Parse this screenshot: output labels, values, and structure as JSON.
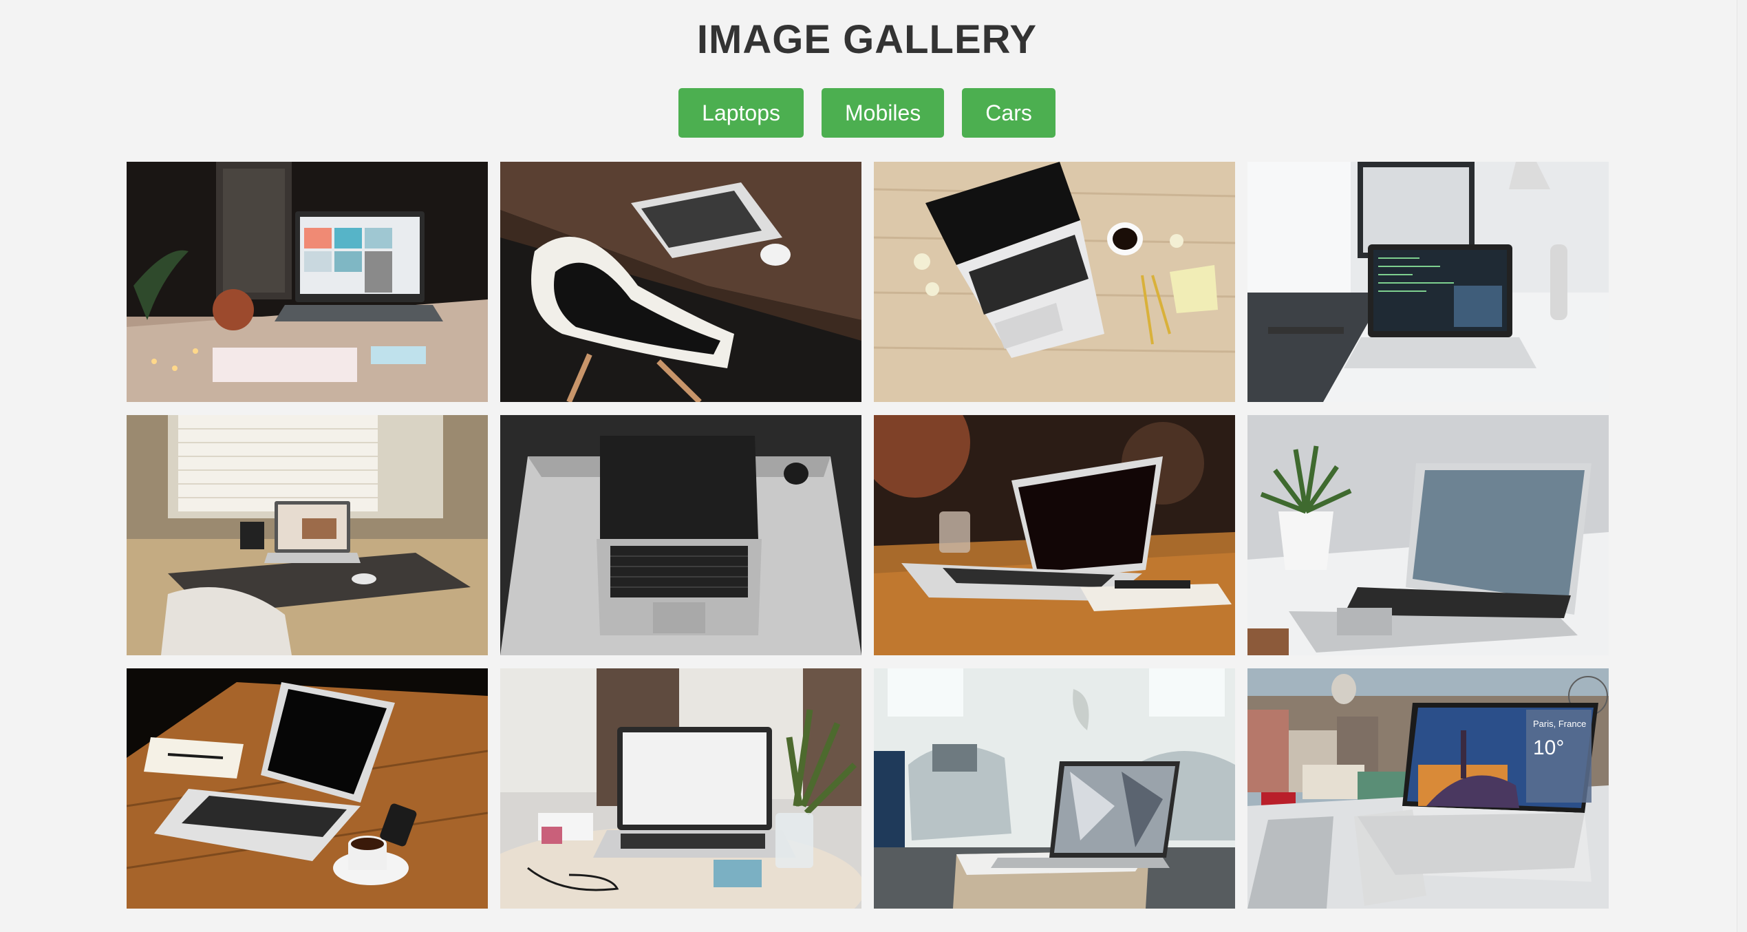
{
  "gallery": {
    "title": "IMAGE GALLERY",
    "filters": [
      {
        "label": "Laptops"
      },
      {
        "label": "Mobiles"
      },
      {
        "label": "Cars"
      }
    ],
    "accent_color": "#4caf50",
    "images": [
      {
        "subject": "laptop on wooden desk with fairy lights and copper mug"
      },
      {
        "subject": "laptop on dark wooden desk with white chair"
      },
      {
        "subject": "laptop top view on light wood with coffee cup"
      },
      {
        "subject": "laptop with code on white desk near window"
      },
      {
        "subject": "laptop on desk by window with blinds"
      },
      {
        "subject": "laptop on white table top view dark"
      },
      {
        "subject": "laptop on wooden table with glass, warm light"
      },
      {
        "subject": "laptop on white desk with potted plant"
      },
      {
        "subject": "laptop on wooden table with notebook and espresso"
      },
      {
        "subject": "laptop on round table with plant and glass"
      },
      {
        "subject": "laptop on marble stand in living room"
      },
      {
        "subject": "laptop with Paris weather screen, city background",
        "screen_text": "Paris, France",
        "screen_temp": "10°"
      }
    ]
  }
}
